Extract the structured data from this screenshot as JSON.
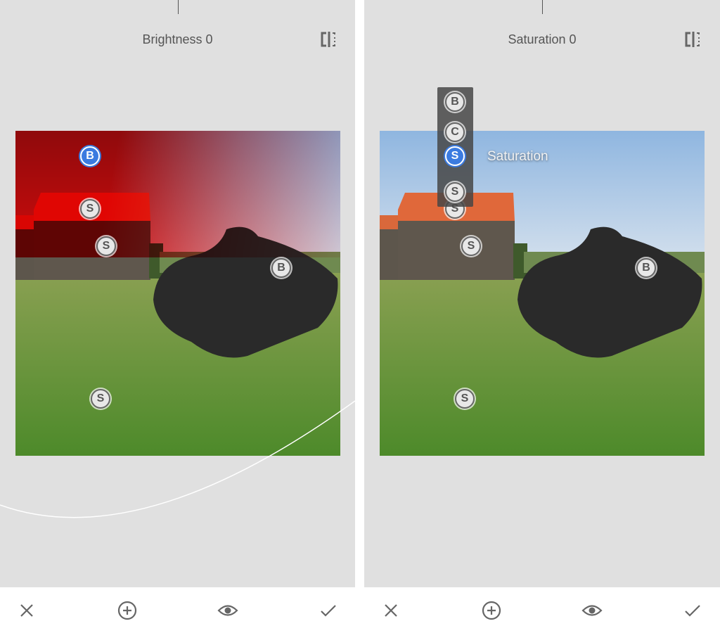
{
  "left": {
    "title": "Brightness 0",
    "pins": [
      {
        "letter": "B",
        "active": true
      },
      {
        "letter": "S"
      },
      {
        "letter": "S"
      },
      {
        "letter": "B"
      },
      {
        "letter": "S"
      }
    ]
  },
  "right": {
    "title": "Saturation 0",
    "pins": [
      {
        "letter": "S"
      },
      {
        "letter": "S"
      },
      {
        "letter": "B"
      },
      {
        "letter": "S"
      }
    ],
    "menu": [
      {
        "letter": "B"
      },
      {
        "letter": "C"
      },
      {
        "letter": "S",
        "active": true
      },
      {
        "letter": "S"
      }
    ],
    "menu_label": "Saturation"
  },
  "icons": [
    "compare-icon",
    "close-icon",
    "add-icon",
    "eye-icon",
    "check-icon"
  ],
  "colors": {
    "accent": "#3b7be0",
    "mask": "#ff0000"
  }
}
